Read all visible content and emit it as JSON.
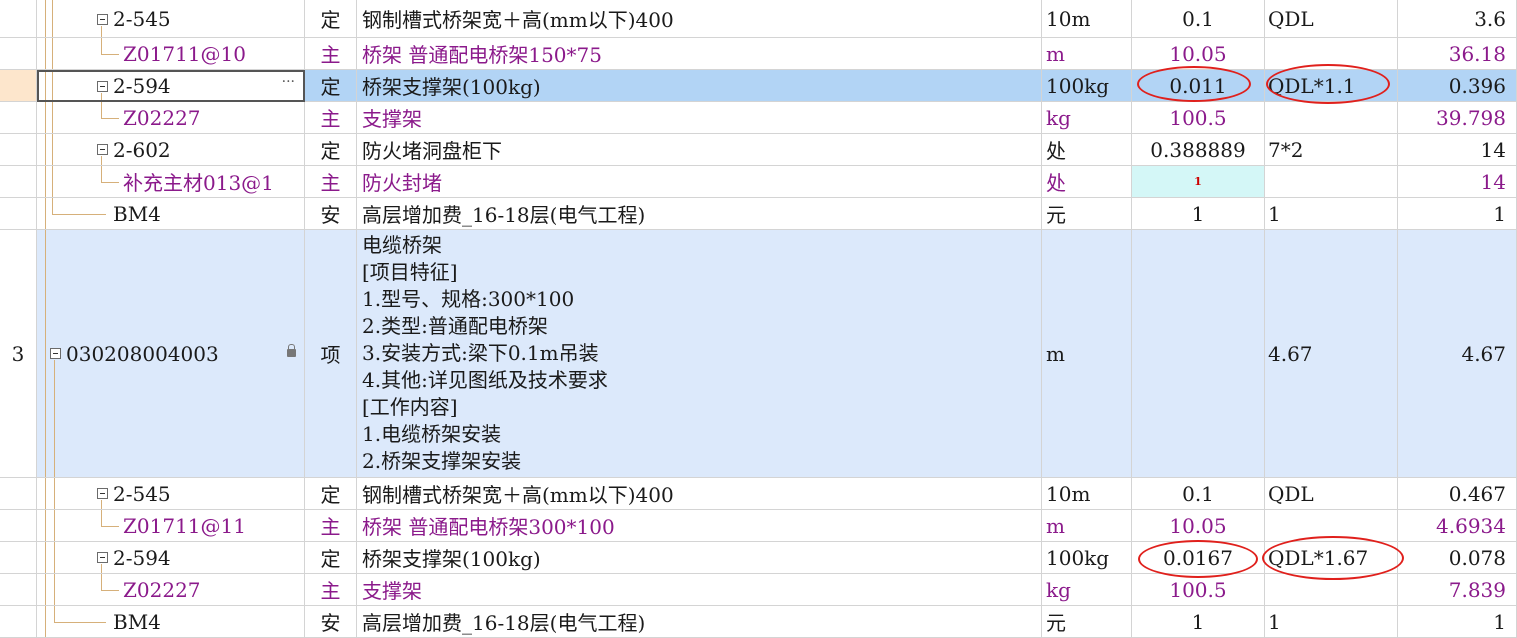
{
  "rows": [
    {
      "code": "2-545",
      "type": "定",
      "name": "钢制槽式桥架宽＋高(mm以下)400",
      "unit": "10m",
      "qty": "0.1",
      "expr": "QDL",
      "amount": "3.6"
    },
    {
      "code": "Z01711@10",
      "type": "主",
      "name": "桥架 普通配电桥架150*75",
      "unit": "m",
      "qty": "10.05",
      "expr": "",
      "amount": "36.18"
    },
    {
      "code": "2-594",
      "type": "定",
      "name": "桥架支撑架(100kg)",
      "unit": "100kg",
      "qty": "0.011",
      "expr": "QDL*1.1",
      "amount": "0.396",
      "more": "···"
    },
    {
      "code": "Z02227",
      "type": "主",
      "name": "支撑架",
      "unit": "kg",
      "qty": "100.5",
      "expr": "",
      "amount": "39.798"
    },
    {
      "code": "2-602",
      "type": "定",
      "name": "防火堵洞盘柜下",
      "unit": "处",
      "qty": "0.388889",
      "expr": "7*2",
      "amount": "14"
    },
    {
      "code": "补充主材013@1",
      "type": "主",
      "name": "防火封堵",
      "unit": "处",
      "qty": "1",
      "expr": "",
      "amount": "14"
    },
    {
      "code": "BM4",
      "type": "安",
      "name": "高层增加费_16-18层(电气工程)",
      "unit": "元",
      "qty": "1",
      "expr": "1",
      "amount": "1"
    },
    {
      "num": "3",
      "code": "030208004003",
      "type": "项",
      "unit": "m",
      "qty": "",
      "expr": "4.67",
      "amount": "4.67",
      "desc": [
        "电缆桥架",
        "[项目特征]",
        "1.型号、规格:300*100",
        "2.类型:普通配电桥架",
        "3.安装方式:梁下0.1m吊装",
        "4.其他:详见图纸及技术要求",
        "[工作内容]",
        "1.电缆桥架安装",
        "2.桥架支撑架安装"
      ]
    },
    {
      "code": "2-545",
      "type": "定",
      "name": "钢制槽式桥架宽＋高(mm以下)400",
      "unit": "10m",
      "qty": "0.1",
      "expr": "QDL",
      "amount": "0.467"
    },
    {
      "code": "Z01711@11",
      "type": "主",
      "name": "桥架 普通配电桥架300*100",
      "unit": "m",
      "qty": "10.05",
      "expr": "",
      "amount": "4.6934"
    },
    {
      "code": "2-594",
      "type": "定",
      "name": "桥架支撑架(100kg)",
      "unit": "100kg",
      "qty": "0.0167",
      "expr": "QDL*1.67",
      "amount": "0.078"
    },
    {
      "code": "Z02227",
      "type": "主",
      "name": "支撑架",
      "unit": "kg",
      "qty": "100.5",
      "expr": "",
      "amount": "7.839"
    },
    {
      "code": "BM4",
      "type": "安",
      "name": "高层增加费_16-18层(电气工程)",
      "unit": "元",
      "qty": "1",
      "expr": "1",
      "amount": "1"
    }
  ],
  "colors": {
    "selected": "#b2d4f5",
    "highlight": "#dce9fb",
    "material": "#8b1a8b",
    "annotation": "#e0201c"
  }
}
